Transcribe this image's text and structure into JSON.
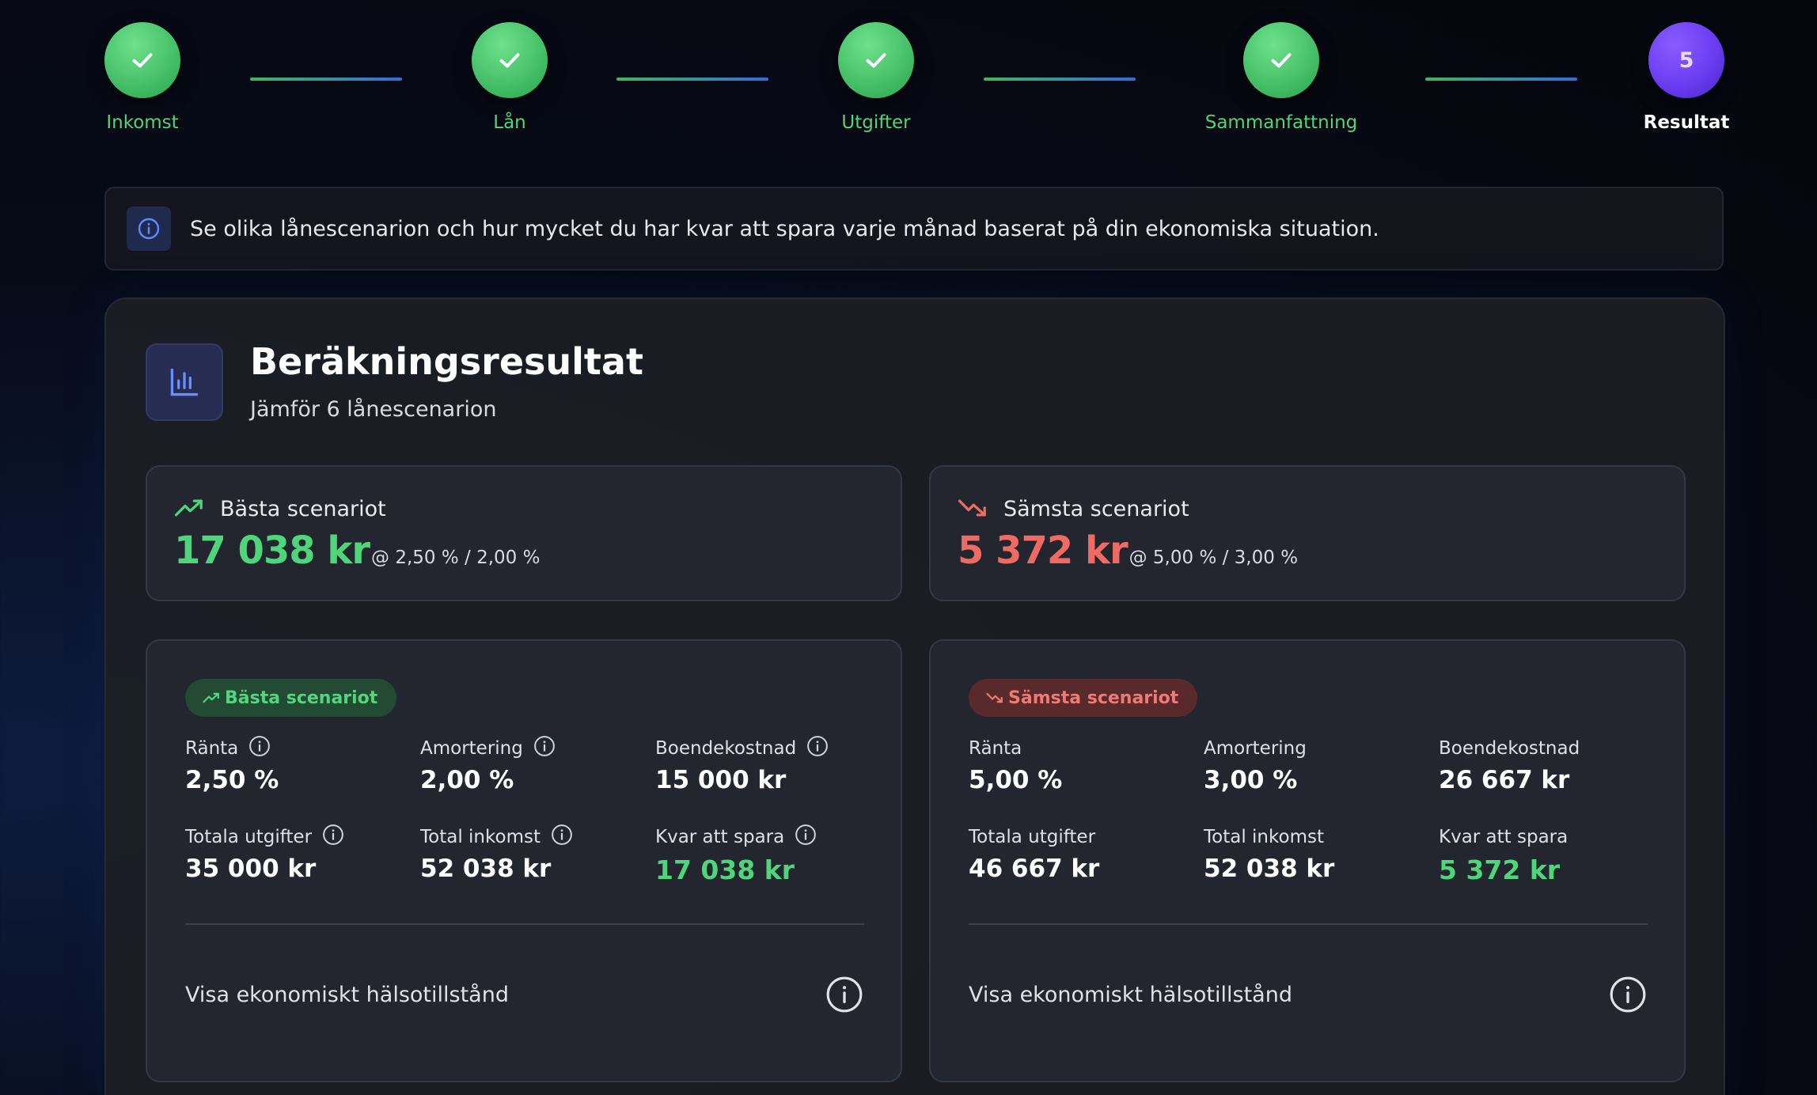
{
  "stepper": {
    "steps": [
      {
        "label": "Inkomst",
        "state": "done"
      },
      {
        "label": "Lån",
        "state": "done"
      },
      {
        "label": "Utgifter",
        "state": "done"
      },
      {
        "label": "Sammanfattning",
        "state": "done"
      },
      {
        "label": "Resultat",
        "state": "active",
        "number": "5"
      }
    ]
  },
  "info": {
    "icon": "info-icon",
    "text": "Se olika lånescenarion och hur mycket du har kvar att spara varje månad baserat på din ekonomiska situation."
  },
  "results": {
    "icon": "bar-chart-icon",
    "title": "Beräkningsresultat",
    "subtitle": "Jämför 6 lånescenarion"
  },
  "best_summary": {
    "icon": "trending-up-icon",
    "title": "Bästa scenariot",
    "value": "17 038 kr",
    "detail": "@ 2,50 % / 2,00 %"
  },
  "worst_summary": {
    "icon": "trending-down-icon",
    "title": "Sämsta scenariot",
    "value": "5 372 kr",
    "detail": "@ 5,00 % / 3,00 %"
  },
  "best_detail": {
    "badge": "Bästa scenariot",
    "ranta_label": "Ränta",
    "ranta_value": "2,50 %",
    "amortering_label": "Amortering",
    "amortering_value": "2,00 %",
    "boendekostnad_label": "Boendekostnad",
    "boendekostnad_value": "15 000 kr",
    "utgifter_label": "Totala utgifter",
    "utgifter_value": "35 000 kr",
    "inkomst_label": "Total inkomst",
    "inkomst_value": "52 038 kr",
    "spara_label": "Kvar att spara",
    "spara_value": "17 038 kr",
    "health_label": "Visa ekonomiskt hälsotillstånd"
  },
  "worst_detail": {
    "badge": "Sämsta scenariot",
    "ranta_label": "Ränta",
    "ranta_value": "5,00 %",
    "amortering_label": "Amortering",
    "amortering_value": "3,00 %",
    "boendekostnad_label": "Boendekostnad",
    "boendekostnad_value": "26 667 kr",
    "utgifter_label": "Totala utgifter",
    "utgifter_value": "46 667 kr",
    "inkomst_label": "Total inkomst",
    "inkomst_value": "52 038 kr",
    "spara_label": "Kvar att spara",
    "spara_value": "5 372 kr",
    "health_label": "Visa ekonomiskt hälsotillstånd"
  },
  "colors": {
    "positive": "#4fd57a",
    "negative": "#ef6a63",
    "active_step": "#6a3df2",
    "accent_blue": "#4a78ff"
  }
}
